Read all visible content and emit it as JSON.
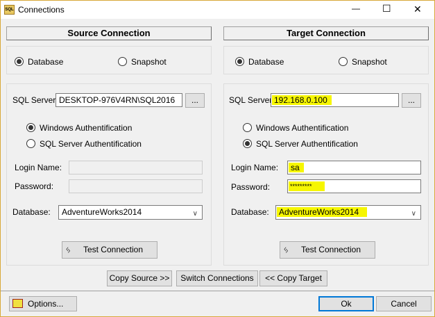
{
  "window": {
    "title": "Connections",
    "minimize": "—",
    "maximize": "☐",
    "close": "✕"
  },
  "source": {
    "header": "Source Connection",
    "radio_database": "Database",
    "radio_snapshot": "Snapshot",
    "mode": "Database",
    "sql_server_label": "SQL Server:",
    "sql_server_value": "DESKTOP-976V4RN\\SQL2016",
    "browse": "...",
    "windows_auth": "Windows Authentification",
    "sql_auth": "SQL Server Authentification",
    "auth": "Windows",
    "login_label": "Login Name:",
    "login_value": "",
    "password_label": "Password:",
    "password_value": "",
    "database_label": "Database:",
    "database_value": "AdventureWorks2014",
    "test": "Test Connection"
  },
  "target": {
    "header": "Target Connection",
    "radio_database": "Database",
    "radio_snapshot": "Snapshot",
    "mode": "Database",
    "sql_server_label": "SQL Server:",
    "sql_server_value": "192.168.0.100",
    "browse": "...",
    "windows_auth": "Windows Authentification",
    "sql_auth": "SQL Server Authentification",
    "auth": "SQL Server",
    "login_label": "Login Name:",
    "login_value": "sa",
    "password_label": "Password:",
    "password_value": "*********",
    "database_label": "Database:",
    "database_value": "AdventureWorks2014",
    "test": "Test Connection"
  },
  "actions": {
    "copy_source": "Copy Source >>",
    "switch": "Switch Connections",
    "copy_target": "<< Copy Target"
  },
  "footer": {
    "options": "Options...",
    "ok": "Ok",
    "cancel": "Cancel"
  },
  "colors": {
    "highlight": "#f6f600",
    "border": "#d8a838",
    "ok_border": "#0078d7"
  }
}
